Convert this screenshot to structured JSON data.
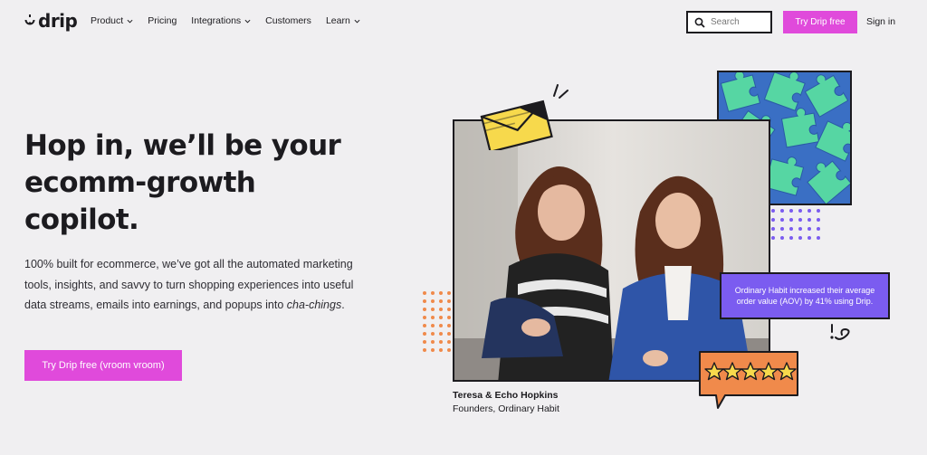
{
  "brand": {
    "name": "drip",
    "accent": "#e04adb"
  },
  "nav": {
    "items": [
      {
        "label": "Product",
        "has_dropdown": true
      },
      {
        "label": "Pricing",
        "has_dropdown": false
      },
      {
        "label": "Integrations",
        "has_dropdown": true
      },
      {
        "label": "Customers",
        "has_dropdown": false
      },
      {
        "label": "Learn",
        "has_dropdown": true
      }
    ],
    "search_placeholder": "Search",
    "cta_label": "Try Drip free",
    "signin_label": "Sign in"
  },
  "hero": {
    "title_lines": [
      "Hop in, we’ll be your",
      "ecomm-growth",
      "copilot."
    ],
    "body": "100% built for ecommerce, we’ve got all the automated marketing tools, insights, and savvy to turn shopping experiences into useful data streams, emails into earnings, and popups into",
    "body_emphasis": "cha-chings",
    "body_end": ".",
    "cta_label": "Try Drip free (vroom vroom)"
  },
  "testimonial": {
    "stat": "Ordinary Habit increased their average order value (AOV) by 41% using Drip.",
    "rating_stars": 5,
    "name": "Teresa & Echo Hopkins",
    "role": "Founders, Ordinary Habit"
  },
  "colors": {
    "purple": "#7b5cf0",
    "orange": "#f08a4b",
    "yellow": "#f7d94c",
    "puzzle_blue": "#3a6fc4",
    "puzzle_green": "#56d6a3"
  }
}
